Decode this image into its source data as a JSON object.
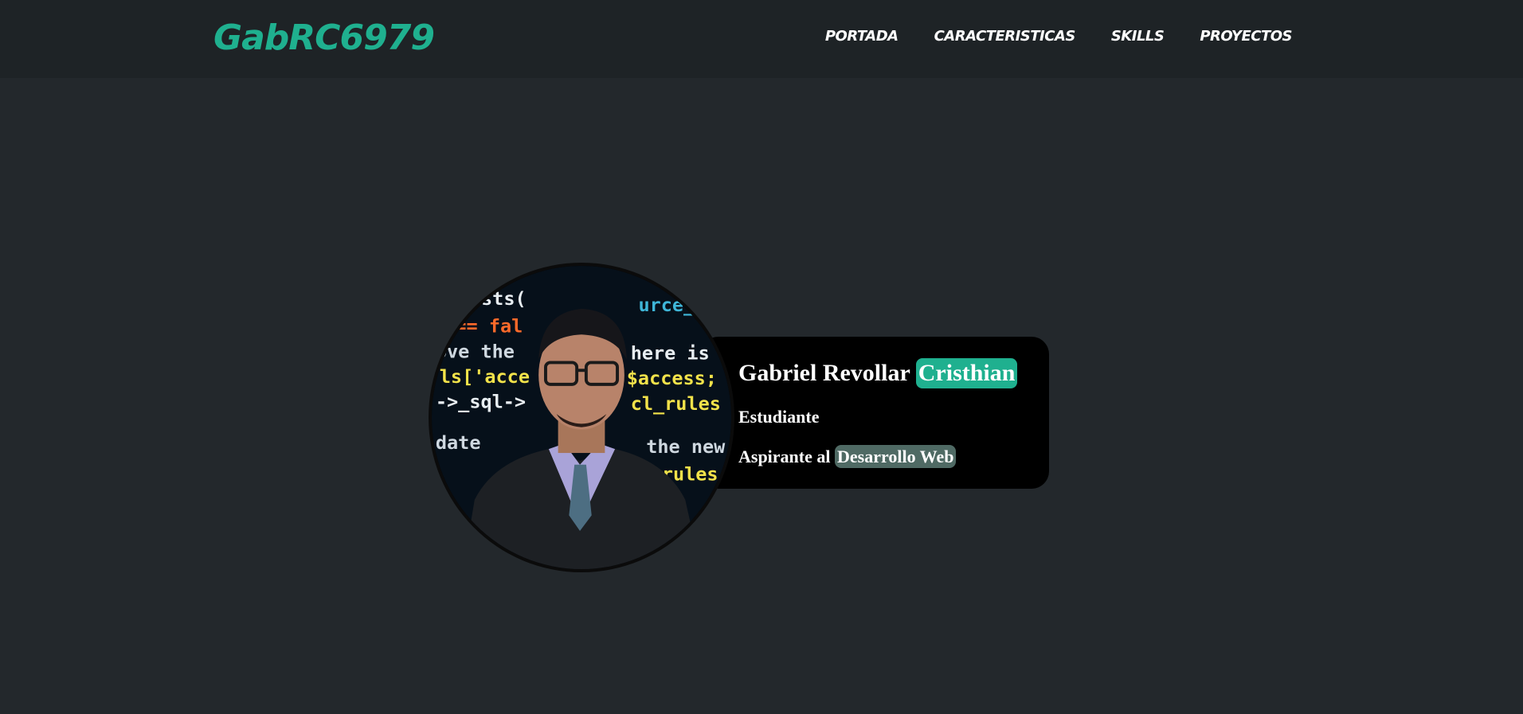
{
  "navbar": {
    "brand": "GabRC6979",
    "links": [
      "PORTADA",
      "CARACTERISTICAS",
      "SKILLS",
      "PROYECTOS"
    ]
  },
  "profile": {
    "photo_alt": "Foto de perfil",
    "name_first": "Gabriel Revollar",
    "name_highlight": "Cristhian",
    "role": "Estudiante",
    "aspire_prefix": "Aspirante al",
    "aspire_highlight": "Desarrollo Web",
    "code_background_text": [
      "exists(",
      "== fal",
      "ove the",
      "ls['acce",
      "->_sql->",
      "date",
      "urce_d",
      "here is",
      "$access;",
      "cl_rules",
      "the new",
      "rules"
    ]
  },
  "colors": {
    "page_bg": "#23282c",
    "navbar_bg": "#1e2326",
    "accent": "#1fb08f",
    "card_bg": "#000000",
    "secondary_highlight": "#4f6a64",
    "text": "#ffffff"
  }
}
